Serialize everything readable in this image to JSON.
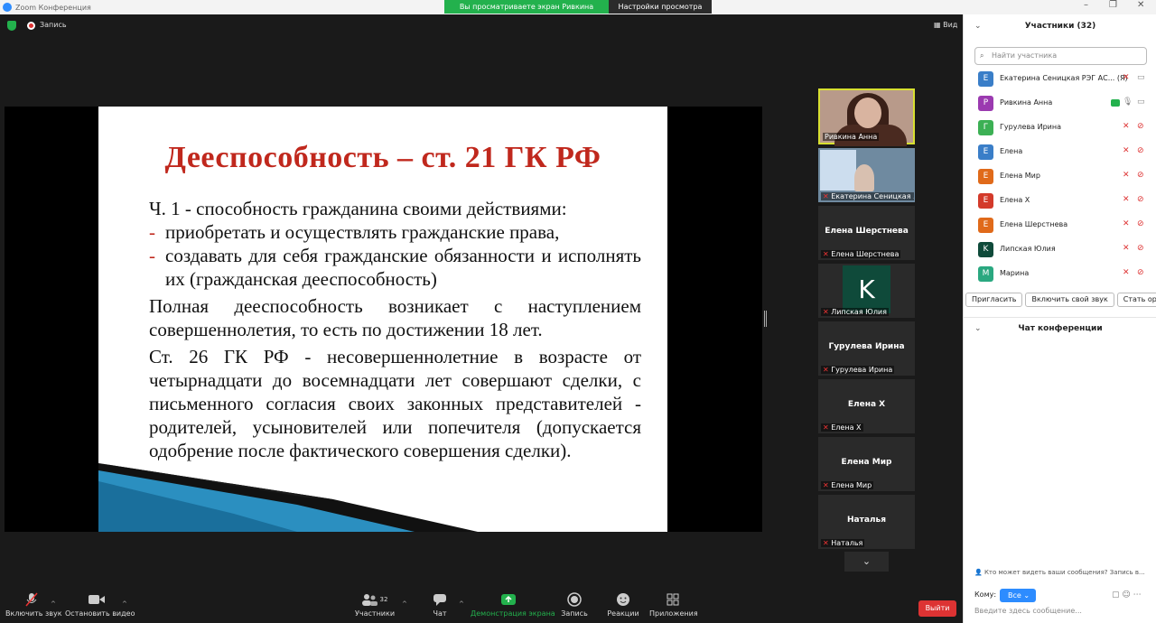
{
  "window": {
    "title": "Zoom Конференция"
  },
  "view_banner": {
    "sharing_text": "Вы просматриваете экран Ривкина Анна",
    "settings_label": "Настройки просмотра"
  },
  "topbar": {
    "record_label": "Запись",
    "view_label": "Вид"
  },
  "slide": {
    "title": "Дееспособность – ст. 21 ГК РФ",
    "p1": "Ч. 1 - способность гражданина своими действиями:",
    "li1": "приобретать и осуществлять гражданские права,",
    "li2": "создавать для себя гражданские обязанности и исполнять их (гражданская дееспособность)",
    "p2": "Полная дееспособность возникает с наступлением совершеннолетия, то есть по достижении 18 лет.",
    "p3": "Ст. 26 ГК РФ - несовершеннолетние в возрасте от четырнадцати до восемнадцати лет совершают сделки, с письменного согласия своих законных представителей - родителей, усыновителей или попечителя (допускается одобрение после фактического совершения сделки)."
  },
  "thumbnails": [
    {
      "caption": "Ривкина Анна",
      "name": ""
    },
    {
      "caption": "Екатерина Сеницкая ...",
      "name": ""
    },
    {
      "caption": "Елена Шерстнева",
      "name": "Елена Шерстнева"
    },
    {
      "caption": "Липская Юлия",
      "name": "K"
    },
    {
      "caption": "Гурулева Ирина",
      "name": "Гурулева Ирина"
    },
    {
      "caption": "Елена Х",
      "name": "Елена Х"
    },
    {
      "caption": "Елена Мир",
      "name": "Елена Мир"
    },
    {
      "caption": "Наталья",
      "name": "Наталья"
    }
  ],
  "toolbar": {
    "mute_label": "Включить звук",
    "video_label": "Остановить видео",
    "participants_label": "Участники",
    "participants_count": "32",
    "chat_label": "Чат",
    "share_label": "Демонстрация экрана",
    "record_label": "Запись",
    "reactions_label": "Реакции",
    "apps_label": "Приложения",
    "leave_label": "Выйти"
  },
  "participants": {
    "header": "Участники (32)",
    "search_placeholder": "Найти участника",
    "list": [
      {
        "initial": "Е",
        "name": "Екатерина Сеницкая РЭГ АС...",
        "tag": "(Я)",
        "color": "#3a7ec8"
      },
      {
        "initial": "Р",
        "name": "Ривкина Анна",
        "tag": "",
        "color": "#9b3ab0"
      },
      {
        "initial": "Г",
        "name": "Гурулева Ирина",
        "tag": "",
        "color": "#3cb054"
      },
      {
        "initial": "Е",
        "name": "Елена",
        "tag": "",
        "color": "#3a7ec8"
      },
      {
        "initial": "Е",
        "name": "Елена Мир",
        "tag": "",
        "color": "#e06a1a"
      },
      {
        "initial": "Е",
        "name": "Елена Х",
        "tag": "",
        "color": "#d33a2a"
      },
      {
        "initial": "Е",
        "name": "Елена Шерстнева",
        "tag": "",
        "color": "#e06a1a"
      },
      {
        "initial": "K",
        "name": "Липская Юлия",
        "tag": "",
        "color": "#0f4a3a"
      },
      {
        "initial": "М",
        "name": "Марина",
        "tag": "",
        "color": "#2aa880"
      }
    ],
    "invite_label": "Пригласить",
    "unmute_label": "Включить свой звук",
    "host_label": "Стать организатором"
  },
  "chat": {
    "header": "Чат конференции",
    "visibility_text": "Кто может видеть ваши сообщения? Запись в...",
    "to_label": "Кому:",
    "to_value": "Все",
    "input_placeholder": "Введите здесь сообщение..."
  }
}
